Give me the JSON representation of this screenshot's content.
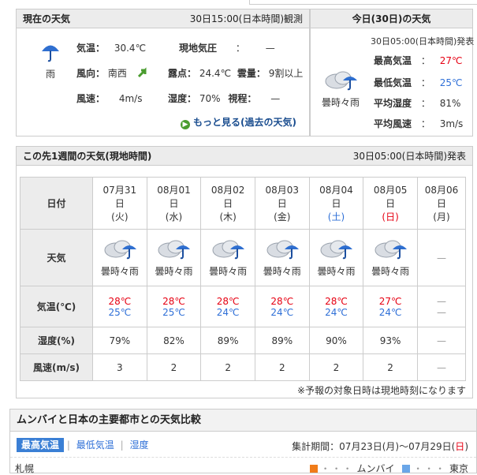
{
  "current": {
    "title": "現在の天気",
    "observed": "30日15:00(日本時間)観測",
    "icon": "umbrella-rain-icon",
    "weather": "雨",
    "temp_label": "気温：",
    "temp_value": "30.4℃",
    "pressure_label": "現地気圧",
    "pressure_sep": "：",
    "pressure_value": "—",
    "wind_dir_label": "風向：",
    "wind_dir_value": "南西",
    "dew_label": "露点：",
    "dew_value": "24.4℃",
    "cloud_label": "雲量：",
    "cloud_value": "9割以上",
    "wind_label": "風速：",
    "wind_value": "4m/s",
    "humid_label": "湿度：",
    "humid_value": "70%",
    "vis_label": "視程：",
    "vis_value": "—",
    "more_link": "もっと見る(過去の天気)"
  },
  "today": {
    "title": "今日(30日)の天気",
    "issued": "30日05:00(日本時間)発表",
    "icon": "cloud-rain-icon",
    "weather": "曇時々雨",
    "max_label": "最高気温",
    "max_value": "27℃",
    "min_label": "最低気温",
    "min_value": "25℃",
    "humid_label": "平均湿度",
    "humid_value": "81%",
    "wind_label": "平均風速",
    "wind_value": "3m/s",
    "sep": "："
  },
  "week": {
    "title": "この先1週間の天気(現地時間)",
    "issued": "30日05:00(日本時間)発表",
    "row_labels": {
      "date": "日付",
      "weather": "天気",
      "temp": "気温(℃)",
      "humid": "湿度(%)",
      "wind": "風速(m/s)"
    },
    "days": [
      {
        "date": "07月31",
        "d": "日",
        "wd": "(火)",
        "weather": "曇時々雨",
        "hi": "28℃",
        "lo": "25℃",
        "humid": "79%",
        "wind": "3"
      },
      {
        "date": "08月01",
        "d": "日",
        "wd": "(水)",
        "weather": "曇時々雨",
        "hi": "28℃",
        "lo": "25℃",
        "humid": "82%",
        "wind": "2"
      },
      {
        "date": "08月02",
        "d": "日",
        "wd": "(木)",
        "weather": "曇時々雨",
        "hi": "28℃",
        "lo": "24℃",
        "humid": "89%",
        "wind": "2"
      },
      {
        "date": "08月03",
        "d": "日",
        "wd": "(金)",
        "weather": "曇時々雨",
        "hi": "28℃",
        "lo": "24℃",
        "humid": "89%",
        "wind": "2"
      },
      {
        "date": "08月04",
        "d": "日",
        "wd": "(土)",
        "weather": "曇時々雨",
        "hi": "28℃",
        "lo": "24℃",
        "humid": "90%",
        "wind": "2"
      },
      {
        "date": "08月05",
        "d": "日",
        "wd": "(日)",
        "weather": "曇時々雨",
        "hi": "27℃",
        "lo": "24℃",
        "humid": "93%",
        "wind": "2"
      },
      {
        "date": "08月06",
        "d": "日",
        "wd": "(月)",
        "weather": "—",
        "hi": "—",
        "lo": "—",
        "humid": "—",
        "wind": "—"
      }
    ],
    "note": "※予報の対象日時は現地時刻になります"
  },
  "compare": {
    "title": "ムンバイと日本の主要都市との天気比較",
    "tab_max": "最高気温",
    "tab_min": "最低気温",
    "tab_humid": "湿度",
    "tab_sep": "|",
    "period_label": "集計期間：",
    "period_a": "07月23日(月)〜07月29日(",
    "period_day": "日",
    "period_close": ")",
    "city": "札幌",
    "legend_dots": "・・・",
    "legend_a": "ムンバイ",
    "legend_b": "東京",
    "color_a": "#f07c1a",
    "color_b": "#6aa6e8"
  }
}
